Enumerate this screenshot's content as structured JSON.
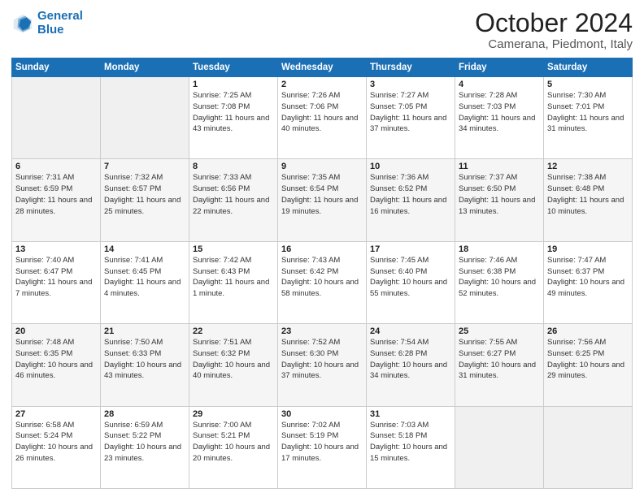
{
  "header": {
    "logo_line1": "General",
    "logo_line2": "Blue",
    "month": "October 2024",
    "location": "Camerana, Piedmont, Italy"
  },
  "weekdays": [
    "Sunday",
    "Monday",
    "Tuesday",
    "Wednesday",
    "Thursday",
    "Friday",
    "Saturday"
  ],
  "weeks": [
    [
      {
        "day": "",
        "sunrise": "",
        "sunset": "",
        "daylight": ""
      },
      {
        "day": "",
        "sunrise": "",
        "sunset": "",
        "daylight": ""
      },
      {
        "day": "1",
        "sunrise": "Sunrise: 7:25 AM",
        "sunset": "Sunset: 7:08 PM",
        "daylight": "Daylight: 11 hours and 43 minutes."
      },
      {
        "day": "2",
        "sunrise": "Sunrise: 7:26 AM",
        "sunset": "Sunset: 7:06 PM",
        "daylight": "Daylight: 11 hours and 40 minutes."
      },
      {
        "day": "3",
        "sunrise": "Sunrise: 7:27 AM",
        "sunset": "Sunset: 7:05 PM",
        "daylight": "Daylight: 11 hours and 37 minutes."
      },
      {
        "day": "4",
        "sunrise": "Sunrise: 7:28 AM",
        "sunset": "Sunset: 7:03 PM",
        "daylight": "Daylight: 11 hours and 34 minutes."
      },
      {
        "day": "5",
        "sunrise": "Sunrise: 7:30 AM",
        "sunset": "Sunset: 7:01 PM",
        "daylight": "Daylight: 11 hours and 31 minutes."
      }
    ],
    [
      {
        "day": "6",
        "sunrise": "Sunrise: 7:31 AM",
        "sunset": "Sunset: 6:59 PM",
        "daylight": "Daylight: 11 hours and 28 minutes."
      },
      {
        "day": "7",
        "sunrise": "Sunrise: 7:32 AM",
        "sunset": "Sunset: 6:57 PM",
        "daylight": "Daylight: 11 hours and 25 minutes."
      },
      {
        "day": "8",
        "sunrise": "Sunrise: 7:33 AM",
        "sunset": "Sunset: 6:56 PM",
        "daylight": "Daylight: 11 hours and 22 minutes."
      },
      {
        "day": "9",
        "sunrise": "Sunrise: 7:35 AM",
        "sunset": "Sunset: 6:54 PM",
        "daylight": "Daylight: 11 hours and 19 minutes."
      },
      {
        "day": "10",
        "sunrise": "Sunrise: 7:36 AM",
        "sunset": "Sunset: 6:52 PM",
        "daylight": "Daylight: 11 hours and 16 minutes."
      },
      {
        "day": "11",
        "sunrise": "Sunrise: 7:37 AM",
        "sunset": "Sunset: 6:50 PM",
        "daylight": "Daylight: 11 hours and 13 minutes."
      },
      {
        "day": "12",
        "sunrise": "Sunrise: 7:38 AM",
        "sunset": "Sunset: 6:48 PM",
        "daylight": "Daylight: 11 hours and 10 minutes."
      }
    ],
    [
      {
        "day": "13",
        "sunrise": "Sunrise: 7:40 AM",
        "sunset": "Sunset: 6:47 PM",
        "daylight": "Daylight: 11 hours and 7 minutes."
      },
      {
        "day": "14",
        "sunrise": "Sunrise: 7:41 AM",
        "sunset": "Sunset: 6:45 PM",
        "daylight": "Daylight: 11 hours and 4 minutes."
      },
      {
        "day": "15",
        "sunrise": "Sunrise: 7:42 AM",
        "sunset": "Sunset: 6:43 PM",
        "daylight": "Daylight: 11 hours and 1 minute."
      },
      {
        "day": "16",
        "sunrise": "Sunrise: 7:43 AM",
        "sunset": "Sunset: 6:42 PM",
        "daylight": "Daylight: 10 hours and 58 minutes."
      },
      {
        "day": "17",
        "sunrise": "Sunrise: 7:45 AM",
        "sunset": "Sunset: 6:40 PM",
        "daylight": "Daylight: 10 hours and 55 minutes."
      },
      {
        "day": "18",
        "sunrise": "Sunrise: 7:46 AM",
        "sunset": "Sunset: 6:38 PM",
        "daylight": "Daylight: 10 hours and 52 minutes."
      },
      {
        "day": "19",
        "sunrise": "Sunrise: 7:47 AM",
        "sunset": "Sunset: 6:37 PM",
        "daylight": "Daylight: 10 hours and 49 minutes."
      }
    ],
    [
      {
        "day": "20",
        "sunrise": "Sunrise: 7:48 AM",
        "sunset": "Sunset: 6:35 PM",
        "daylight": "Daylight: 10 hours and 46 minutes."
      },
      {
        "day": "21",
        "sunrise": "Sunrise: 7:50 AM",
        "sunset": "Sunset: 6:33 PM",
        "daylight": "Daylight: 10 hours and 43 minutes."
      },
      {
        "day": "22",
        "sunrise": "Sunrise: 7:51 AM",
        "sunset": "Sunset: 6:32 PM",
        "daylight": "Daylight: 10 hours and 40 minutes."
      },
      {
        "day": "23",
        "sunrise": "Sunrise: 7:52 AM",
        "sunset": "Sunset: 6:30 PM",
        "daylight": "Daylight: 10 hours and 37 minutes."
      },
      {
        "day": "24",
        "sunrise": "Sunrise: 7:54 AM",
        "sunset": "Sunset: 6:28 PM",
        "daylight": "Daylight: 10 hours and 34 minutes."
      },
      {
        "day": "25",
        "sunrise": "Sunrise: 7:55 AM",
        "sunset": "Sunset: 6:27 PM",
        "daylight": "Daylight: 10 hours and 31 minutes."
      },
      {
        "day": "26",
        "sunrise": "Sunrise: 7:56 AM",
        "sunset": "Sunset: 6:25 PM",
        "daylight": "Daylight: 10 hours and 29 minutes."
      }
    ],
    [
      {
        "day": "27",
        "sunrise": "Sunrise: 6:58 AM",
        "sunset": "Sunset: 5:24 PM",
        "daylight": "Daylight: 10 hours and 26 minutes."
      },
      {
        "day": "28",
        "sunrise": "Sunrise: 6:59 AM",
        "sunset": "Sunset: 5:22 PM",
        "daylight": "Daylight: 10 hours and 23 minutes."
      },
      {
        "day": "29",
        "sunrise": "Sunrise: 7:00 AM",
        "sunset": "Sunset: 5:21 PM",
        "daylight": "Daylight: 10 hours and 20 minutes."
      },
      {
        "day": "30",
        "sunrise": "Sunrise: 7:02 AM",
        "sunset": "Sunset: 5:19 PM",
        "daylight": "Daylight: 10 hours and 17 minutes."
      },
      {
        "day": "31",
        "sunrise": "Sunrise: 7:03 AM",
        "sunset": "Sunset: 5:18 PM",
        "daylight": "Daylight: 10 hours and 15 minutes."
      },
      {
        "day": "",
        "sunrise": "",
        "sunset": "",
        "daylight": ""
      },
      {
        "day": "",
        "sunrise": "",
        "sunset": "",
        "daylight": ""
      }
    ]
  ]
}
